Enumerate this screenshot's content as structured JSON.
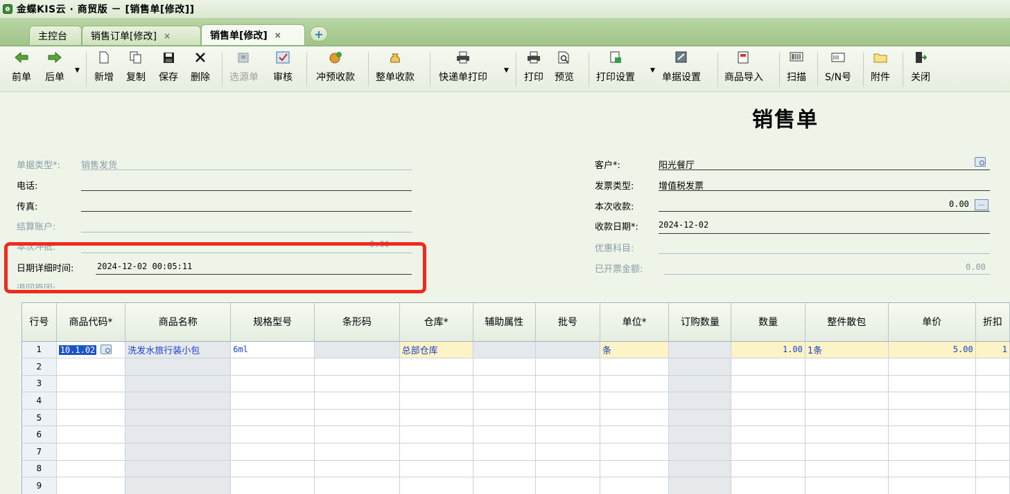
{
  "window": {
    "title": "金蝶KIS云 · 商贸版 － [销售单[修改]]"
  },
  "tabs": [
    {
      "label": "主控台",
      "closable": false
    },
    {
      "label": "销售订单[修改]",
      "closable": true
    },
    {
      "label": "销售单[修改]",
      "closable": true,
      "active": true
    }
  ],
  "tab_close_glyph": "×",
  "tab_add_glyph": "+",
  "toolbar": {
    "prev": "前单",
    "next": "后单",
    "new": "新增",
    "copy": "复制",
    "save": "保存",
    "delete": "删除",
    "select_source": "选源单",
    "audit": "审核",
    "offset_prepay": "冲预收款",
    "full_receipt": "整单收款",
    "express_print": "快递单打印",
    "print": "打印",
    "preview": "预览",
    "print_settings": "打印设置",
    "doc_settings": "单据设置",
    "import_goods": "商品导入",
    "scan": "扫描",
    "sn": "S/N号",
    "attachment": "附件",
    "close": "关闭"
  },
  "form": {
    "title": "销售单",
    "left": {
      "doc_type_label": "单据类型*:",
      "doc_type_value": "销售发货",
      "phone_label": "电话:",
      "phone_value": "",
      "fax_label": "传真:",
      "fax_value": "",
      "account_label": "结算账户:",
      "account_value": "",
      "offset_label": "本次冲抵:",
      "offset_value": "0.00",
      "datetime_label": "日期详细时间:",
      "datetime_value": "2024-12-02 00:05:11",
      "return_reason_label": "退回原因:"
    },
    "right": {
      "customer_label": "客户*:",
      "customer_value": "阳光餐厅",
      "invoice_type_label": "发票类型:",
      "invoice_type_value": "增值税发票",
      "received_label": "本次收款:",
      "received_value": "0.00",
      "receive_date_label": "收款日期*:",
      "receive_date_value": "2024-12-02",
      "discount_subject_label": "优惠科目:",
      "discount_subject_value": "",
      "invoiced_amount_label": "已开票金额:",
      "invoiced_amount_value": "0.00"
    }
  },
  "grid": {
    "columns": [
      "行号",
      "商品代码*",
      "商品名称",
      "规格型号",
      "条形码",
      "仓库*",
      "辅助属性",
      "批号",
      "单位*",
      "订购数量",
      "数量",
      "整件散包",
      "单价",
      "折扣"
    ],
    "rows": [
      {
        "no": "1",
        "code": "10.1.02",
        "name": "洗发水旅行装小包",
        "spec": "6ml",
        "barcode": "",
        "warehouse": "总部仓库",
        "aux": "",
        "batch": "",
        "unit": "条",
        "order_qty": "",
        "qty": "1.00",
        "pack": "1条",
        "price": "5.00",
        "discount": "1"
      },
      {
        "no": "2"
      },
      {
        "no": "3"
      },
      {
        "no": "4"
      },
      {
        "no": "5"
      },
      {
        "no": "6"
      },
      {
        "no": "7"
      },
      {
        "no": "8"
      },
      {
        "no": "9"
      }
    ]
  }
}
